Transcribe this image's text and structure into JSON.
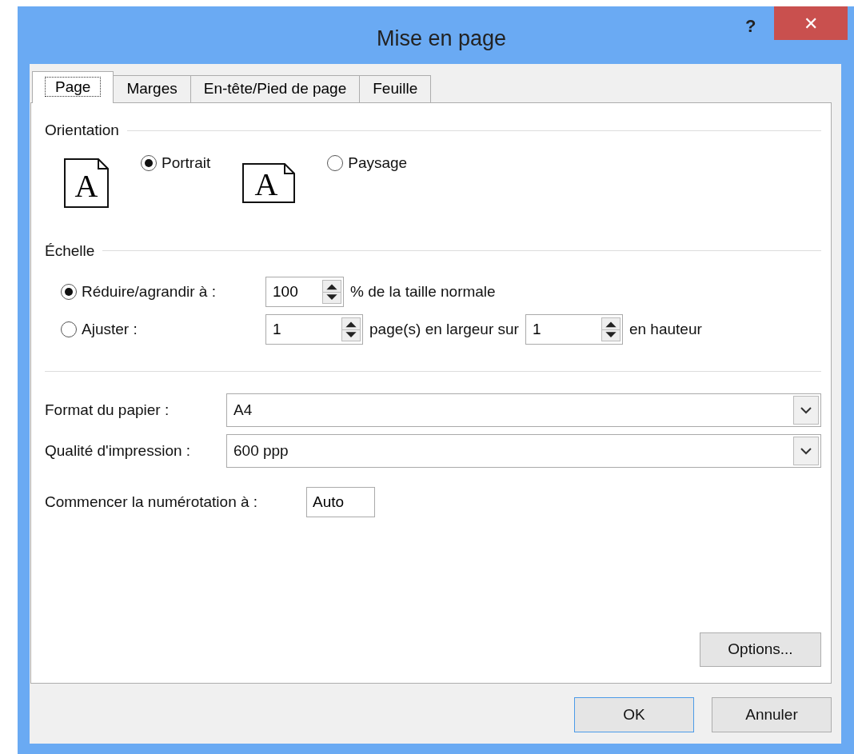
{
  "window": {
    "title": "Mise en page",
    "help": "?",
    "close": "✕"
  },
  "tabs": [
    {
      "label": "Page",
      "selected": true
    },
    {
      "label": "Marges",
      "selected": false
    },
    {
      "label": "En-tête/Pied de page",
      "selected": false
    },
    {
      "label": "Feuille",
      "selected": false
    }
  ],
  "orientation": {
    "title": "Orientation",
    "options": [
      {
        "kind": "portrait",
        "icon_letter": "A",
        "label": "Portrait",
        "selected": true
      },
      {
        "kind": "landscape",
        "icon_letter": "A",
        "label": "Paysage",
        "selected": false
      }
    ]
  },
  "scale": {
    "title": "Échelle",
    "options": [
      {
        "label": "Réduire/agrandir à :",
        "selected": true,
        "parts": [
          {
            "kind": "spin",
            "value": "100"
          },
          {
            "kind": "text",
            "text": "% de la taille normale"
          }
        ]
      },
      {
        "label": "Ajuster :",
        "selected": false,
        "parts": [
          {
            "kind": "spin",
            "value": "1"
          },
          {
            "kind": "text",
            "text": "page(s) en largeur sur"
          },
          {
            "kind": "spin",
            "value": "1"
          },
          {
            "kind": "text",
            "text": "en hauteur"
          }
        ]
      }
    ]
  },
  "paper": [
    {
      "label": "Format du papier :",
      "value": "A4"
    },
    {
      "label": "Qualité d'impression :",
      "value": "600 ppp"
    }
  ],
  "first_page": {
    "label": "Commencer la numérotation à :",
    "value": "Auto"
  },
  "options_button": "Options...",
  "buttons": [
    {
      "label": "OK",
      "default": true
    },
    {
      "label": "Annuler",
      "default": false
    }
  ]
}
